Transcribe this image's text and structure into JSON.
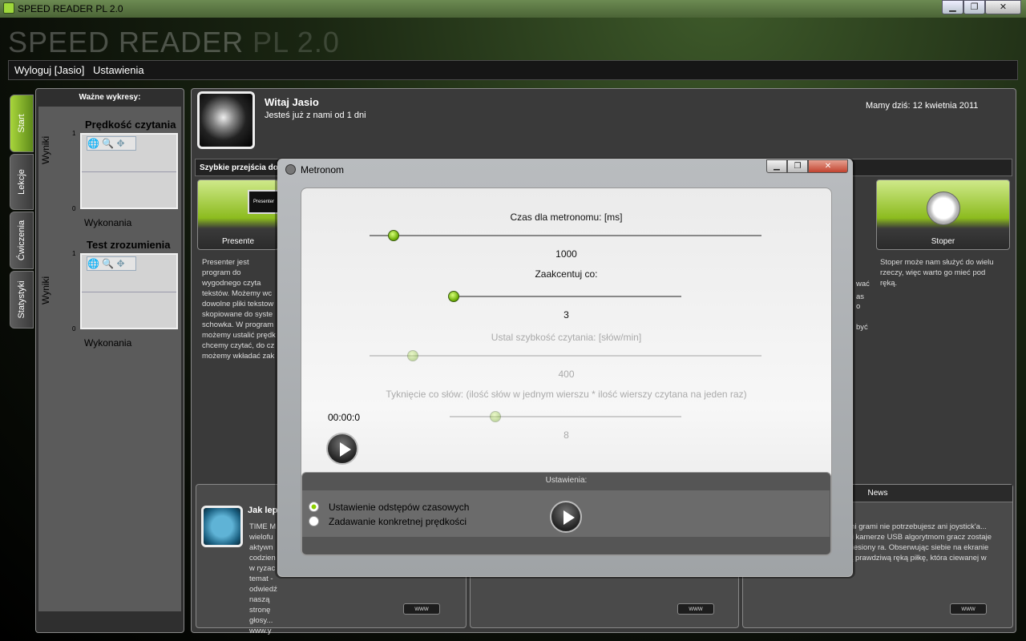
{
  "window": {
    "title": "SPEED READER PL 2.0",
    "big_title_main": "SPEED READER",
    "big_title_version": "PL 2.0",
    "min": "▁",
    "max": "❐",
    "close": "✕"
  },
  "menu": {
    "logout": "Wyloguj  [Jasio]",
    "settings": "Ustawienia"
  },
  "side_tabs": [
    "Start",
    "Lekcje",
    "Ćwiczenia",
    "Statystyki"
  ],
  "left_panel": {
    "header": "Ważne wykresy:",
    "chart1": {
      "title": "Prędkość czytania",
      "ylabel": "Wyniki",
      "xlabel": "Wykonania",
      "y_top": "1",
      "y_bottom": "0"
    },
    "chart2": {
      "title": "Test zrozumienia",
      "ylabel": "Wyniki",
      "xlabel": "Wykonania",
      "y_top": "1",
      "y_bottom": "0"
    }
  },
  "welcome": {
    "greeting": "Witaj   Jasio",
    "since": "Jesteś już z nami od 1 dni",
    "date": "Mamy dziś: 12 kwietnia 2011"
  },
  "quick": {
    "header": "Szybkie przejścia do n",
    "tiles": [
      {
        "label": "Presente",
        "icon": "monitor-icon",
        "icon_text": "Presenter"
      },
      {
        "label": "Stoper",
        "icon": "clock-icon"
      }
    ],
    "desc_presenter": "Presenter jest program do wygodnego czyta tekstów. Możemy wc dowolne pliki tekstow skopiowane do syste schowka. W program możemy ustalić prędk chcemy czytać, do cz możemy wkładać zak",
    "desc_stoper": "Stoper może nam służyć do wielu rzeczy, więc warto go mieć pod ręką.",
    "desc_frag1": "as",
    "desc_frag2": "wać",
    "desc_frag3": "o",
    "desc_frag4": "być"
  },
  "news": {
    "left_title": "Jak lep",
    "left_text": "TIME M wielofu aktywn codzien w ryzac temat - odwiedź naszą stronę głosy... www.y",
    "right_head": "News",
    "right_text": "aszymi grami nie potrzebujesz ani joystick'a... Dzięki kamerze USB algorytmom gracz zostaje przeniesiony ra. Obserwując siebie na ekranie naszą prawdziwą ręką piłkę, która ciewanej w grze!",
    "www": "www"
  },
  "dialog": {
    "title": "Metronom",
    "label_time": "Czas dla metronomu: [ms]",
    "value_time": "1000",
    "label_accent": "Zaakcentuj co:",
    "value_accent": "3",
    "label_speed": "Ustal szybkość czytania: [słów/min]",
    "value_speed": "400",
    "label_tick": "Tyknięcie co słów: (ilość słów w jednym wierszu * ilość wierszy czytana na jeden raz)",
    "value_tick": "8",
    "timer": "00:00:0",
    "settings_header": "Ustawienia:",
    "option1": "Ustawienie odstępów czasowych",
    "option2": "Zadawanie konkretnej prędkości",
    "selected_option": 1
  },
  "colors": {
    "accent": "#8cbb1e",
    "thumb": "#66a800"
  }
}
